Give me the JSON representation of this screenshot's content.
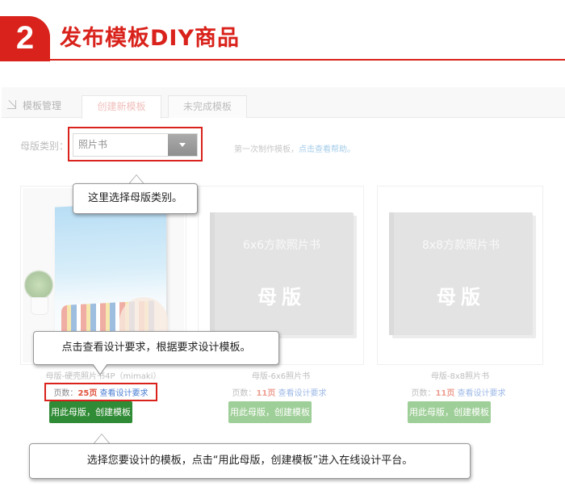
{
  "header": {
    "step_number": "2",
    "title": "发布模板DIY商品",
    "accent_color": "#d9221b"
  },
  "tabs": {
    "section_label": "模板管理",
    "items": [
      {
        "label": "创建新模板",
        "active": true
      },
      {
        "label": "未完成模板",
        "active": false
      }
    ]
  },
  "category": {
    "label": "母版类别：",
    "selected": "照片书",
    "first_time_text": "第一次制作模板，",
    "help_link": "点击查看帮助。"
  },
  "cards": [
    {
      "name": "母版-硬壳照片书4P（mimaki）",
      "pages_label": "页数：",
      "pages_value": "25页",
      "requirements_link": "查看设计要求",
      "button": "用此母版，创建模板",
      "cover_text": "",
      "cover_badge": ""
    },
    {
      "name": "母版-6x6照片书",
      "pages_label": "页数：",
      "pages_value": "11页",
      "requirements_link": "查看设计要求",
      "button": "用此母版，创建模板",
      "cover_text": "6x6方款照片书",
      "cover_badge": "母版"
    },
    {
      "name": "母版-8x8照片书",
      "pages_label": "页数：",
      "pages_value": "11页",
      "requirements_link": "查看设计要求",
      "button": "用此母版，创建模板",
      "cover_text": "8x8方款照片书",
      "cover_badge": "母版"
    }
  ],
  "callouts": {
    "select_category": "这里选择母版类别。",
    "view_requirements": "点击查看设计要求，根据要求设计模板。",
    "choose_template": "选择您要设计的模板，点击“用此母版，创建模板”进入在线设计平台。"
  },
  "icons": {
    "tab_section_icon": "corner-arrow-icon",
    "select_arrow": "chevron-down-icon"
  },
  "colors": {
    "highlight_border": "#d9221b",
    "primary_button": "#2f8b35",
    "disabled_button": "#9fcf98",
    "link": "#4a7ed3"
  }
}
